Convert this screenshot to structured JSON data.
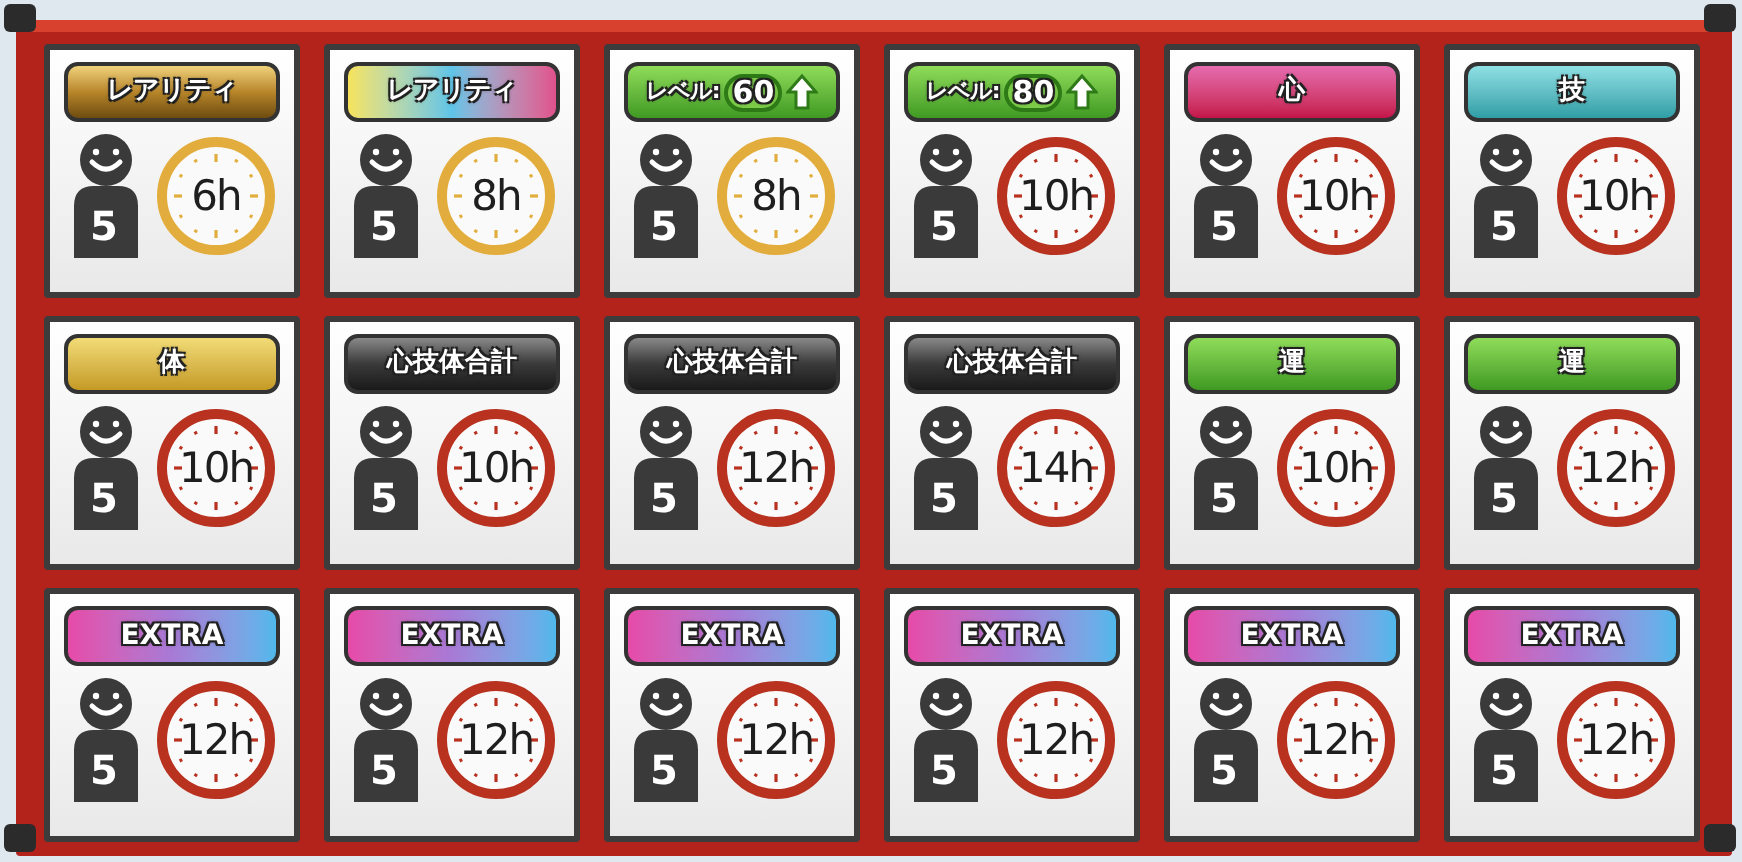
{
  "cards": [
    {
      "badge": {
        "kind": "gold",
        "label": "レアリティ"
      },
      "count": "5",
      "timer": {
        "text": "6h",
        "color": "#e2ad3c"
      }
    },
    {
      "badge": {
        "kind": "rainbow",
        "label": "レアリティ"
      },
      "count": "5",
      "timer": {
        "text": "8h",
        "color": "#e2ad3c"
      }
    },
    {
      "badge": {
        "kind": "level",
        "label": "レベル:",
        "value": "60"
      },
      "count": "5",
      "timer": {
        "text": "8h",
        "color": "#e2ad3c"
      }
    },
    {
      "badge": {
        "kind": "level",
        "label": "レベル:",
        "value": "80"
      },
      "count": "5",
      "timer": {
        "text": "10h",
        "color": "#b8321f"
      }
    },
    {
      "badge": {
        "kind": "pink",
        "label": "心"
      },
      "count": "5",
      "timer": {
        "text": "10h",
        "color": "#b8321f"
      }
    },
    {
      "badge": {
        "kind": "teal",
        "label": "技"
      },
      "count": "5",
      "timer": {
        "text": "10h",
        "color": "#b8321f"
      }
    },
    {
      "badge": {
        "kind": "yellow",
        "label": "体"
      },
      "count": "5",
      "timer": {
        "text": "10h",
        "color": "#b8321f"
      }
    },
    {
      "badge": {
        "kind": "black",
        "label": "心技体合計"
      },
      "count": "5",
      "timer": {
        "text": "10h",
        "color": "#b8321f"
      }
    },
    {
      "badge": {
        "kind": "black",
        "label": "心技体合計"
      },
      "count": "5",
      "timer": {
        "text": "12h",
        "color": "#b8321f"
      }
    },
    {
      "badge": {
        "kind": "black",
        "label": "心技体合計"
      },
      "count": "5",
      "timer": {
        "text": "14h",
        "color": "#b8321f"
      }
    },
    {
      "badge": {
        "kind": "green",
        "label": "運"
      },
      "count": "5",
      "timer": {
        "text": "10h",
        "color": "#b8321f"
      }
    },
    {
      "badge": {
        "kind": "green",
        "label": "運"
      },
      "count": "5",
      "timer": {
        "text": "12h",
        "color": "#b8321f"
      }
    },
    {
      "badge": {
        "kind": "extra",
        "label": "EXTRA"
      },
      "count": "5",
      "timer": {
        "text": "12h",
        "color": "#b8321f"
      }
    },
    {
      "badge": {
        "kind": "extra",
        "label": "EXTRA"
      },
      "count": "5",
      "timer": {
        "text": "12h",
        "color": "#b8321f"
      }
    },
    {
      "badge": {
        "kind": "extra",
        "label": "EXTRA"
      },
      "count": "5",
      "timer": {
        "text": "12h",
        "color": "#b8321f"
      }
    },
    {
      "badge": {
        "kind": "extra",
        "label": "EXTRA"
      },
      "count": "5",
      "timer": {
        "text": "12h",
        "color": "#b8321f"
      }
    },
    {
      "badge": {
        "kind": "extra",
        "label": "EXTRA"
      },
      "count": "5",
      "timer": {
        "text": "12h",
        "color": "#b8321f"
      }
    },
    {
      "badge": {
        "kind": "extra",
        "label": "EXTRA"
      },
      "count": "5",
      "timer": {
        "text": "12h",
        "color": "#b8321f"
      }
    }
  ]
}
